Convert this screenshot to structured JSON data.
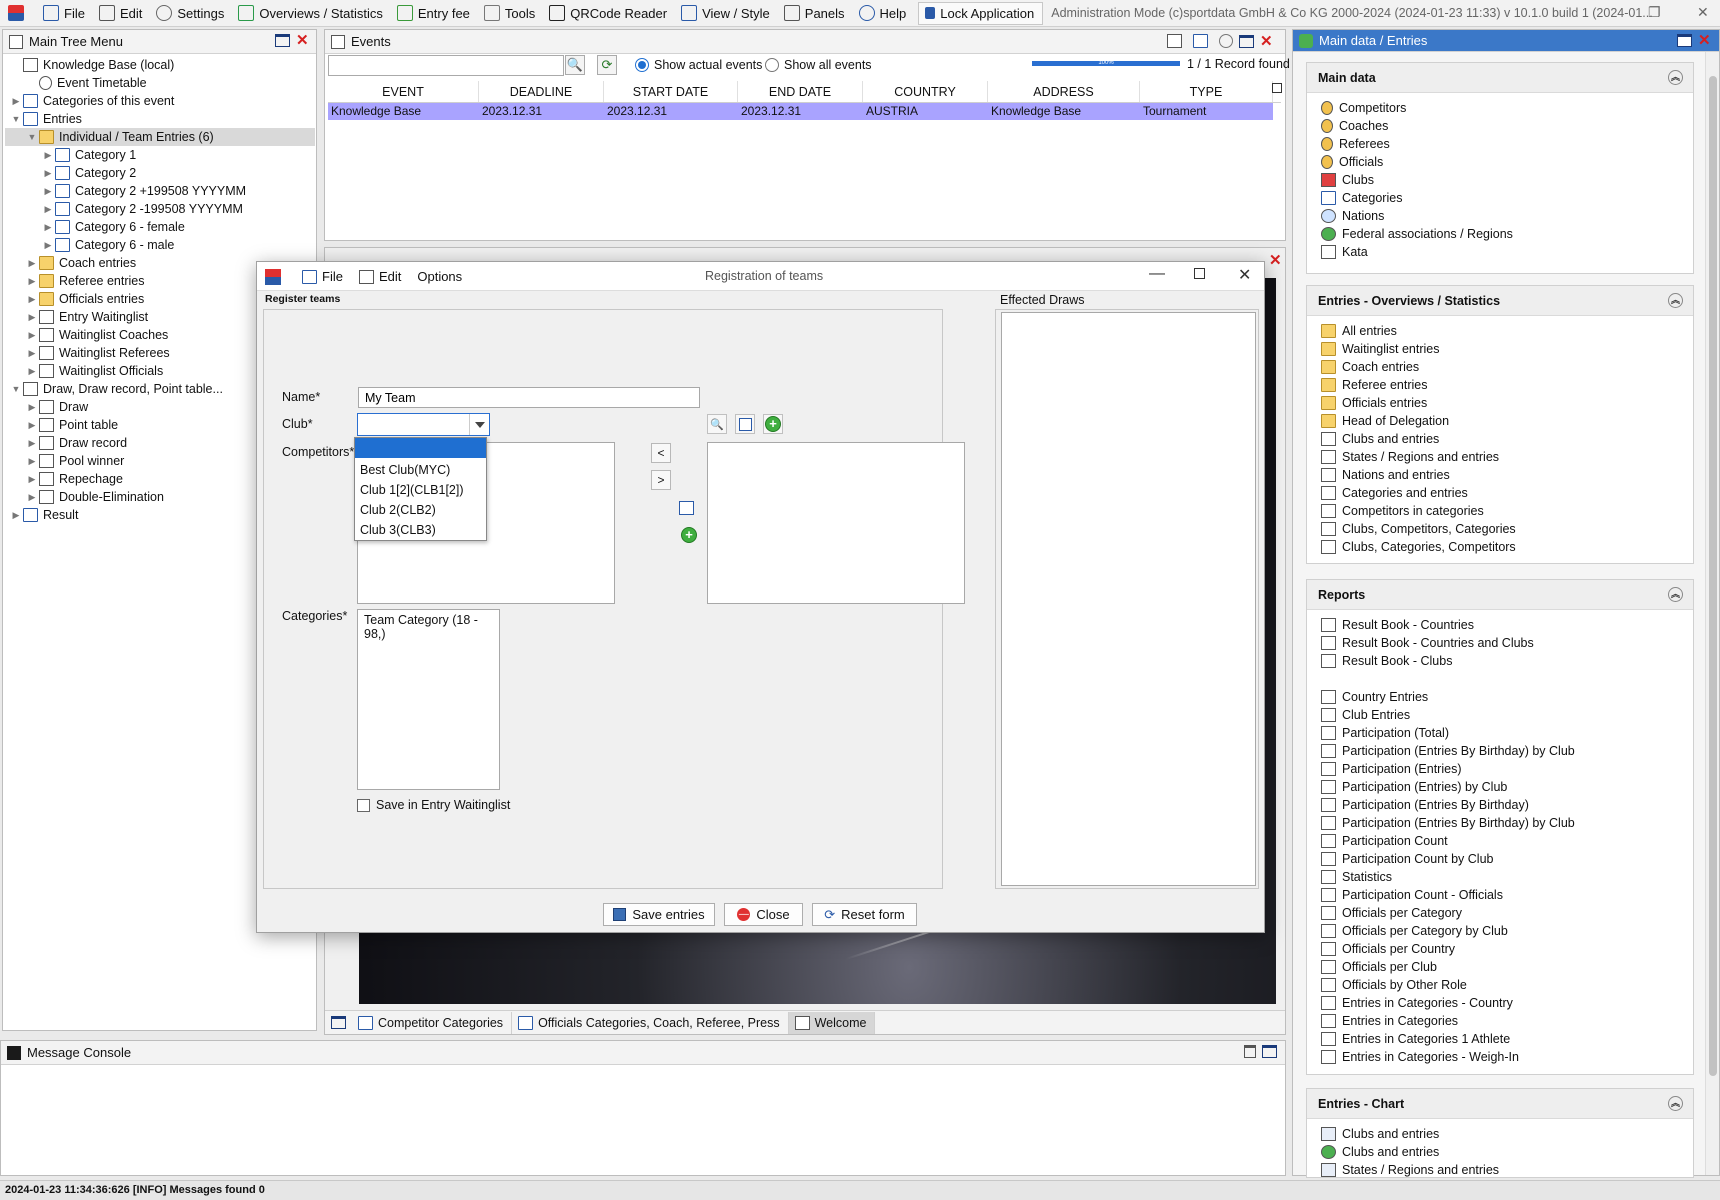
{
  "menubar": {
    "items": [
      {
        "label": "File",
        "icon": "file-icon"
      },
      {
        "label": "Edit",
        "icon": "edit-icon"
      },
      {
        "label": "Settings",
        "icon": "gear-icon"
      },
      {
        "label": "Overviews / Statistics",
        "icon": "overview-icon"
      },
      {
        "label": "Entry fee",
        "icon": "money-icon"
      },
      {
        "label": "Tools",
        "icon": "wrench-icon"
      },
      {
        "label": "QRCode Reader",
        "icon": "qrcode-icon"
      },
      {
        "label": "View / Style",
        "icon": "view-icon"
      },
      {
        "label": "Panels",
        "icon": "panels-icon"
      },
      {
        "label": "Help",
        "icon": "help-icon"
      }
    ],
    "lock_label": "Lock Application",
    "title": "Administration Mode (c)sportdata GmbH & Co KG 2000-2024 (2024-01-23 11:33)  v 10.1.0 build 1 (2024-01..."
  },
  "tree": {
    "title": "Main Tree Menu",
    "items": [
      {
        "label": "Knowledge Base (local)",
        "level": 0,
        "tw": "",
        "icon": "doc"
      },
      {
        "label": "Event Timetable",
        "level": 1,
        "tw": "",
        "icon": "clock"
      },
      {
        "label": "Categories of this event",
        "level": 0,
        "tw": "▶",
        "icon": "folderb"
      },
      {
        "label": "Entries",
        "level": 0,
        "tw": "▼",
        "icon": "folderb"
      },
      {
        "label": "Individual / Team Entries (6)",
        "level": 1,
        "tw": "▼",
        "icon": "folder",
        "selected": true
      },
      {
        "label": "Category 1",
        "level": 2,
        "tw": "▶",
        "icon": "folderb"
      },
      {
        "label": "Category 2",
        "level": 2,
        "tw": "▶",
        "icon": "folderb"
      },
      {
        "label": "Category 2 +199508 YYYYMM",
        "level": 2,
        "tw": "▶",
        "icon": "folderb"
      },
      {
        "label": "Category 2 -199508 YYYYMM",
        "level": 2,
        "tw": "▶",
        "icon": "folderb"
      },
      {
        "label": "Category 6 - female",
        "level": 2,
        "tw": "▶",
        "icon": "folderb"
      },
      {
        "label": "Category 6 - male",
        "level": 2,
        "tw": "▶",
        "icon": "folderb"
      },
      {
        "label": "Coach entries",
        "level": 1,
        "tw": "▶",
        "icon": "folder"
      },
      {
        "label": "Referee entries",
        "level": 1,
        "tw": "▶",
        "icon": "folder"
      },
      {
        "label": "Officials entries",
        "level": 1,
        "tw": "▶",
        "icon": "folder"
      },
      {
        "label": "Entry Waitinglist",
        "level": 1,
        "tw": "▶",
        "icon": "doc"
      },
      {
        "label": "Waitinglist Coaches",
        "level": 1,
        "tw": "▶",
        "icon": "doc"
      },
      {
        "label": "Waitinglist Referees",
        "level": 1,
        "tw": "▶",
        "icon": "doc"
      },
      {
        "label": "Waitinglist Officials",
        "level": 1,
        "tw": "▶",
        "icon": "doc"
      },
      {
        "label": "Draw, Draw record, Point table...",
        "level": 0,
        "tw": "▼",
        "icon": "doc"
      },
      {
        "label": "Draw",
        "level": 1,
        "tw": "▶",
        "icon": "doc"
      },
      {
        "label": "Point table",
        "level": 1,
        "tw": "▶",
        "icon": "doc"
      },
      {
        "label": "Draw record",
        "level": 1,
        "tw": "▶",
        "icon": "doc"
      },
      {
        "label": "Pool winner",
        "level": 1,
        "tw": "▶",
        "icon": "doc"
      },
      {
        "label": "Repechage",
        "level": 1,
        "tw": "▶",
        "icon": "doc"
      },
      {
        "label": "Double-Elimination",
        "level": 1,
        "tw": "▶",
        "icon": "doc"
      },
      {
        "label": "Result",
        "level": 0,
        "tw": "▶",
        "icon": "folderb"
      }
    ]
  },
  "events": {
    "title": "Events",
    "search_value": "",
    "radio_actual": "Show actual events",
    "radio_all": "Show all events",
    "record_count": "1 / 1 Record found",
    "progress_text": "100%",
    "columns": [
      "EVENT",
      "DEADLINE",
      "START DATE",
      "END DATE",
      "COUNTRY",
      "ADDRESS",
      "TYPE"
    ],
    "row": [
      "Knowledge Base",
      "2023.12.31",
      "2023.12.31",
      "2023.12.31",
      "AUSTRIA",
      "Knowledge Base",
      "Tournament"
    ]
  },
  "dialog": {
    "title": "Registration of teams",
    "menu": [
      "File",
      "Edit",
      "Options"
    ],
    "group_label": "Register teams",
    "effected_draws": "Effected Draws",
    "name_label": "Name*",
    "name_value": "My Team",
    "club_label": "Club*",
    "club_value": "",
    "competitors_label": "Competitors*",
    "categories_label": "Categories*",
    "categories_items": [
      "Team Category (18 - 98,)"
    ],
    "club_options": [
      "",
      "Best Club(MYC)",
      "Club 1[2](CLB1[2])",
      "Club 2(CLB2)",
      "Club 3(CLB3)"
    ],
    "move_left": "<",
    "move_right": ">",
    "waitinglist_label": "Save in Entry Waitinglist",
    "save_label": "Save entries",
    "close_label": "Close",
    "reset_label": "Reset form"
  },
  "tabs": [
    "Competitor Categories",
    "Officials Categories, Coach, Referee, Press",
    "Welcome"
  ],
  "console": {
    "title": "Message Console"
  },
  "statusbar": "2024-01-23 11:34:36:626 [INFO] Messages found 0",
  "right": {
    "title": "Main data / Entries",
    "sections": [
      {
        "title": "Main data",
        "items": [
          "Competitors",
          "Coaches",
          "Referees",
          "Officials",
          "Clubs",
          "Categories",
          "Nations",
          "Federal associations / Regions",
          "Kata"
        ]
      },
      {
        "title": "Entries - Overviews / Statistics",
        "items": [
          "All entries",
          "Waitinglist entries",
          "Coach entries",
          "Referee entries",
          "Officials entries",
          "Head of Delegation",
          "Clubs and entries",
          "States / Regions and entries",
          "Nations and entries",
          "Categories and entries",
          "Competitors in categories",
          "Clubs, Competitors, Categories",
          "Clubs, Categories, Competitors"
        ]
      },
      {
        "title": "Reports",
        "items": [
          "Result Book - Countries",
          "Result Book - Countries and Clubs",
          "Result Book - Clubs",
          "",
          "Country Entries",
          "Club Entries",
          "Participation (Total)",
          "Participation (Entries By Birthday) by Club",
          "Participation (Entries)",
          "Participation (Entries) by Club",
          "Participation (Entries By Birthday)",
          "Participation (Entries By Birthday) by Club",
          "Participation Count",
          "Participation Count by Club",
          "Statistics",
          "Participation Count - Officials",
          "Officials per Category",
          "Officials per Category by Club",
          "Officials per Country",
          "Officials per Club",
          "Officials by Other Role",
          "Entries in Categories - Country",
          "Entries in Categories",
          "Entries in Categories 1 Athlete",
          "Entries in Categories - Weigh-In"
        ]
      },
      {
        "title": "Entries - Chart",
        "items": [
          "Clubs and entries",
          "Clubs and entries",
          "States / Regions and entries"
        ]
      }
    ]
  },
  "colors": {
    "selection": "#a9a3ff",
    "dropdown_highlight": "#1f6fd1",
    "accent": "#2a5aa8"
  }
}
